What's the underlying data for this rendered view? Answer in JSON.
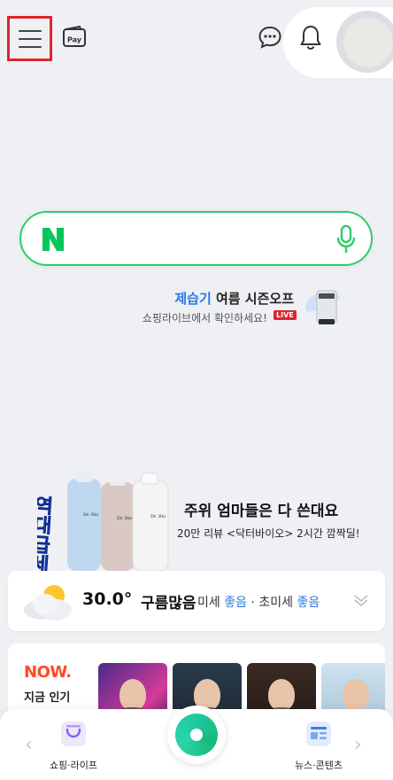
{
  "header": {
    "menu_icon": "hamburger-menu-icon",
    "pay_label": "Pay",
    "chat_icon": "chat-bubble-icon",
    "bell_icon": "bell-icon"
  },
  "search": {
    "logo": "N",
    "placeholder": "",
    "mic_icon": "microphone-icon",
    "accent": "#2fcc6b"
  },
  "promo_small": {
    "highlight": "제습기",
    "title_rest": " 여름 시즌오프",
    "subtitle": "쇼핑라이브에서 확인하세요!",
    "badge": "LIVE"
  },
  "ad": {
    "side_text": "역대급세일",
    "title": "주위 엄마들은 다 쓴대요",
    "subtitle": "20만 리뷰 <닥터바이오> 2시간 깜짝딜!",
    "bottle_brand": "Dr. Bio"
  },
  "weather": {
    "temperature": "30.0°",
    "condition": "구름많음",
    "fine_dust_label": "미세",
    "fine_dust_value": "좋음",
    "separator": " · ",
    "ultrafine_label": "초미세",
    "ultrafine_value": "좋음"
  },
  "trending": {
    "label": "NOW.",
    "sublabel": "지금 인기"
  },
  "bottom_nav": {
    "left_label": "쇼핑·라이프",
    "right_label": "뉴스·콘텐츠"
  },
  "colors": {
    "accent_green": "#2fcc6b",
    "highlight_blue": "#2a7ae2",
    "now_orange": "#ff4a24",
    "live_red": "#e0242a"
  }
}
